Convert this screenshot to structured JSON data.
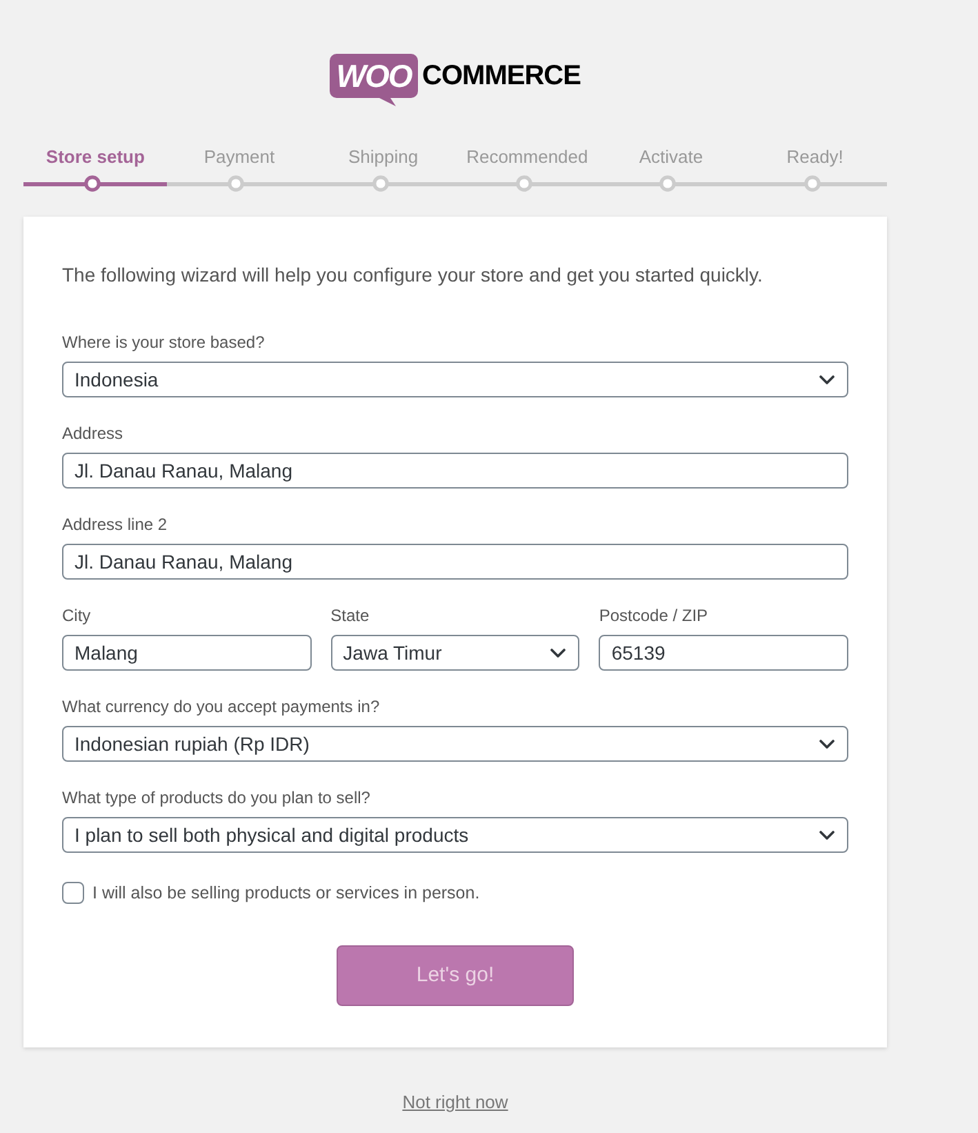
{
  "logo": {
    "badge": "WOO",
    "wordmark": "COMMERCE"
  },
  "steps": [
    {
      "label": "Store setup",
      "active": true
    },
    {
      "label": "Payment",
      "active": false
    },
    {
      "label": "Shipping",
      "active": false
    },
    {
      "label": "Recommended",
      "active": false
    },
    {
      "label": "Activate",
      "active": false
    },
    {
      "label": "Ready!",
      "active": false
    }
  ],
  "intro": "The following wizard will help you configure your store and get you started quickly.",
  "form": {
    "rows": [
      [
        {
          "label": "Where is your store based?",
          "kind": "select",
          "value": "Indonesia"
        }
      ],
      [
        {
          "label": "Address",
          "kind": "text",
          "value": "Jl. Danau Ranau, Malang"
        }
      ],
      [
        {
          "label": "Address line 2",
          "kind": "text",
          "value": "Jl. Danau Ranau, Malang"
        }
      ],
      [
        {
          "label": "City",
          "kind": "text",
          "value": "Malang"
        },
        {
          "label": "State",
          "kind": "select",
          "value": "Jawa Timur"
        },
        {
          "label": "Postcode / ZIP",
          "kind": "text",
          "value": "65139"
        }
      ],
      [
        {
          "label": "What currency do you accept payments in?",
          "kind": "select",
          "value": "Indonesian rupiah (Rp IDR)"
        }
      ],
      [
        {
          "label": "What type of products do you plan to sell?",
          "kind": "select",
          "value": "I plan to sell both physical and digital products"
        }
      ]
    ]
  },
  "in_person_checkbox": {
    "label": "I will also be selling products or services in person.",
    "checked": false
  },
  "submit_button": {
    "label": "Let's go!"
  },
  "skip_link": {
    "label": "Not right now"
  }
}
